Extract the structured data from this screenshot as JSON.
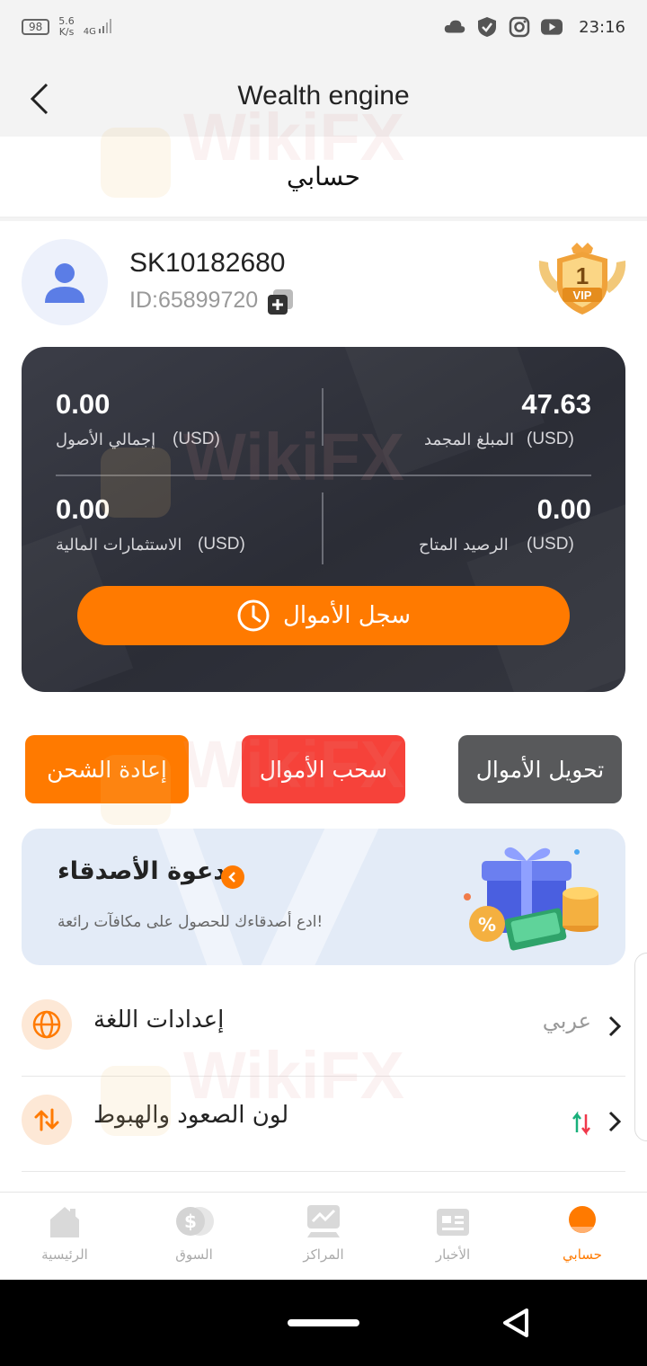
{
  "status_bar": {
    "battery": "98",
    "net_speed_value": "5.6",
    "net_speed_unit": "K/s",
    "network": "4G",
    "time": "23:16",
    "icons": [
      "cloud-icon",
      "shield-icon",
      "instagram-icon",
      "youtube-icon"
    ]
  },
  "header": {
    "title": "Wealth engine"
  },
  "subheader": {
    "title": "حسابي"
  },
  "profile": {
    "username": "SK10182680",
    "user_id": "ID:65899720",
    "vip_level": "1",
    "vip_label": "VIP"
  },
  "balances": {
    "total_assets": {
      "value": "0.00",
      "label": "إجمالي الأصول",
      "unit": "(USD)"
    },
    "frozen_amount": {
      "value": "47.63",
      "label": "المبلغ المجمد",
      "unit": "(USD)"
    },
    "financial_investments": {
      "value": "0.00",
      "label": "الاستثمارات المالية",
      "unit": "(USD)"
    },
    "available_balance": {
      "value": "0.00",
      "label": "الرصيد المتاح",
      "unit": "(USD)"
    },
    "history_button": "سجل الأموال"
  },
  "actions": {
    "recharge": "إعادة الشحن",
    "withdraw": "سحب الأموال",
    "transfer": "تحويل الأموال"
  },
  "invite": {
    "title": "دعوة الأصدقاء",
    "subtitle": "ادع أصدقاءك للحصول على مكافآت رائعة!"
  },
  "settings": [
    {
      "label": "إعدادات اللغة",
      "value": "عربي",
      "icon": "globe-icon"
    },
    {
      "label": "لون الصعود والهبوط",
      "value": "",
      "icon": "up-down-arrows-icon"
    }
  ],
  "bottom_nav": [
    {
      "label": "الرئيسية",
      "icon": "home-icon",
      "active": false
    },
    {
      "label": "السوق",
      "icon": "dollar-coin-icon",
      "active": false
    },
    {
      "label": "المراكز",
      "icon": "positions-icon",
      "active": false
    },
    {
      "label": "الأخبار",
      "icon": "news-icon",
      "active": false
    },
    {
      "label": "حسابي",
      "icon": "account-icon",
      "active": true
    }
  ],
  "watermark": "WikiFX",
  "colors": {
    "accent": "#ff7a00",
    "withdraw": "#f6423a",
    "transfer": "#58595b",
    "card_dark": "#2f313a"
  }
}
